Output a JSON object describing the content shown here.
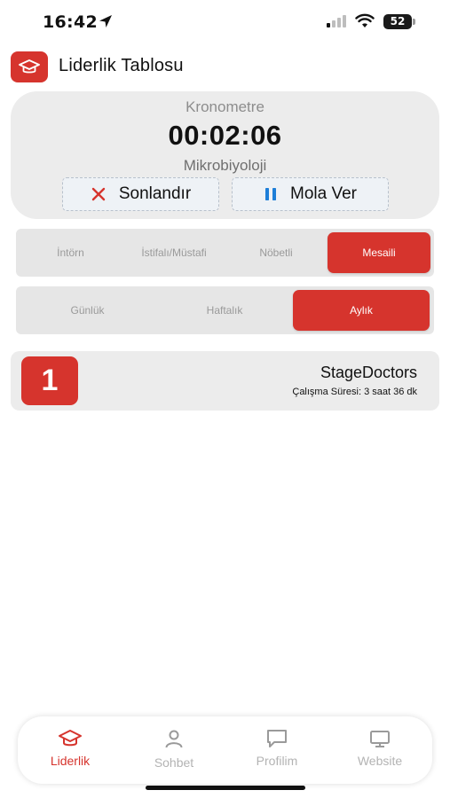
{
  "status_bar": {
    "time": "16:42",
    "battery": "52"
  },
  "header": {
    "title": "Liderlik Tablosu",
    "logo_icon": "graduation-cap-icon"
  },
  "timer": {
    "label": "Kronometre",
    "value": "00:02:06",
    "subject": "Mikrobiyoloji",
    "stop_label": "Sonlandır",
    "pause_label": "Mola Ver"
  },
  "role_filter": {
    "options": [
      "İntörn",
      "İstifalı/Müstafi",
      "Nöbetli",
      "Mesaili"
    ],
    "selected": "Mesaili"
  },
  "period_filter": {
    "options": [
      "Günlük",
      "Haftalık",
      "Aylık"
    ],
    "selected": "Aylık"
  },
  "leaderboard": [
    {
      "rank": "1",
      "name": "StageDoctors",
      "detail": "Çalışma Süresi: 3 saat 36 dk"
    }
  ],
  "tabs": [
    {
      "label": "Liderlik",
      "icon": "graduation-cap-icon",
      "active": true
    },
    {
      "label": "Sohbet",
      "icon": "person-icon",
      "active": false
    },
    {
      "label": "Profilim",
      "icon": "chat-bubble-icon",
      "active": false
    },
    {
      "label": "Website",
      "icon": "monitor-icon",
      "active": false
    }
  ],
  "colors": {
    "accent": "#d6342d",
    "pause_icon": "#1e7fd8"
  }
}
